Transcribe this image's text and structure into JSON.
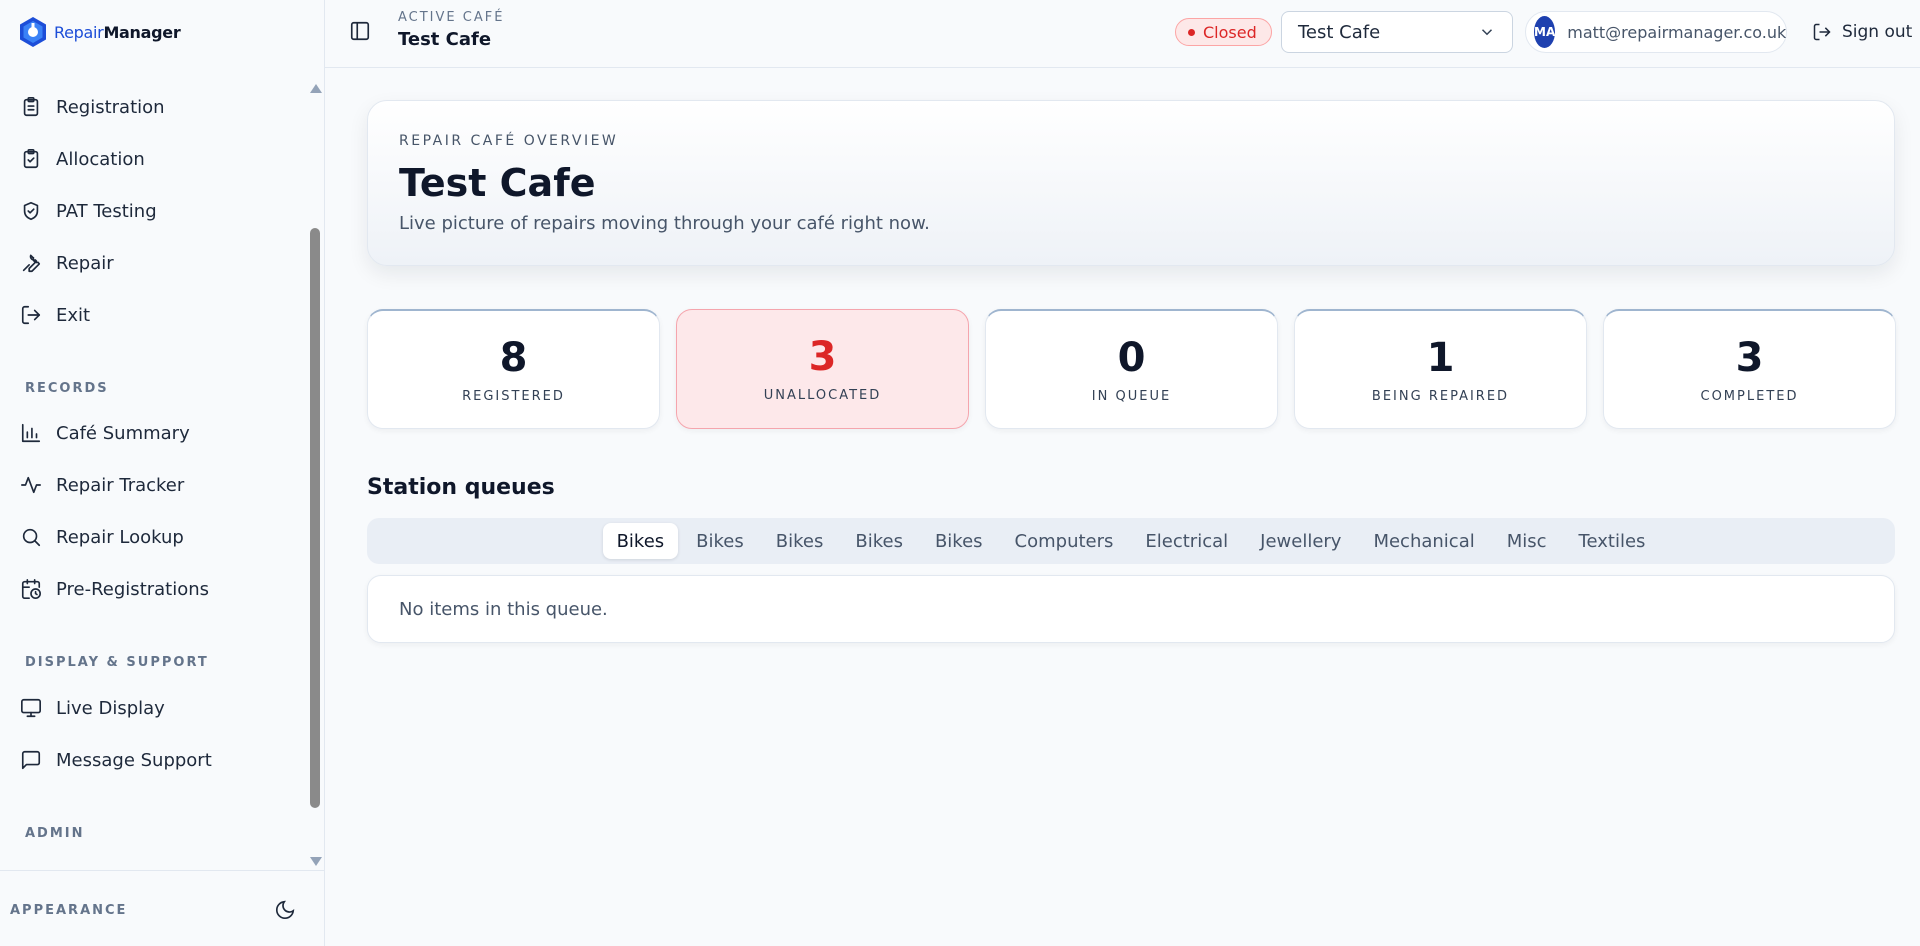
{
  "brand": {
    "part1": "Repair",
    "part2": "Manager"
  },
  "sidebar": {
    "items": [
      {
        "label": "Registration",
        "icon": "clipboard-list-icon"
      },
      {
        "label": "Allocation",
        "icon": "clipboard-check-icon"
      },
      {
        "label": "PAT Testing",
        "icon": "shield-check-icon"
      },
      {
        "label": "Repair",
        "icon": "wrench-icon"
      },
      {
        "label": "Exit",
        "icon": "log-out-icon"
      }
    ],
    "records_heading": "RECORDS",
    "records": [
      {
        "label": "Café Summary",
        "icon": "bar-chart-icon"
      },
      {
        "label": "Repair Tracker",
        "icon": "activity-icon"
      },
      {
        "label": "Repair Lookup",
        "icon": "search-icon"
      },
      {
        "label": "Pre-Registrations",
        "icon": "calendar-clock-icon"
      }
    ],
    "display_heading": "DISPLAY & SUPPORT",
    "display": [
      {
        "label": "Live Display",
        "icon": "monitor-icon"
      },
      {
        "label": "Message Support",
        "icon": "message-square-icon"
      }
    ],
    "admin_heading": "ADMIN",
    "appearance_label": "APPEARANCE",
    "theme_icon": "moon-icon"
  },
  "header": {
    "active_label": "ACTIVE CAFÉ",
    "active_name": "Test Cafe",
    "status": "Closed",
    "status_color": "#dc2626",
    "cafe_select_value": "Test Cafe",
    "avatar_initials": "MA",
    "user_email": "matt@repairmanager.co.uk",
    "signout_label": "Sign out"
  },
  "overview": {
    "eyebrow": "REPAIR CAFÉ OVERVIEW",
    "title": "Test Cafe",
    "subtitle": "Live picture of repairs moving through your café right now."
  },
  "stats": [
    {
      "value": "8",
      "label": "REGISTERED"
    },
    {
      "value": "3",
      "label": "UNALLOCATED"
    },
    {
      "value": "0",
      "label": "IN QUEUE"
    },
    {
      "value": "1",
      "label": "BEING REPAIRED"
    },
    {
      "value": "3",
      "label": "COMPLETED"
    }
  ],
  "queues": {
    "title": "Station queues",
    "tabs": [
      "Bikes",
      "Bikes",
      "Bikes",
      "Bikes",
      "Bikes",
      "Computers",
      "Electrical",
      "Jewellery",
      "Mechanical",
      "Misc",
      "Textiles"
    ],
    "active_tab": "Bikes",
    "empty_message": "No items in this queue."
  }
}
